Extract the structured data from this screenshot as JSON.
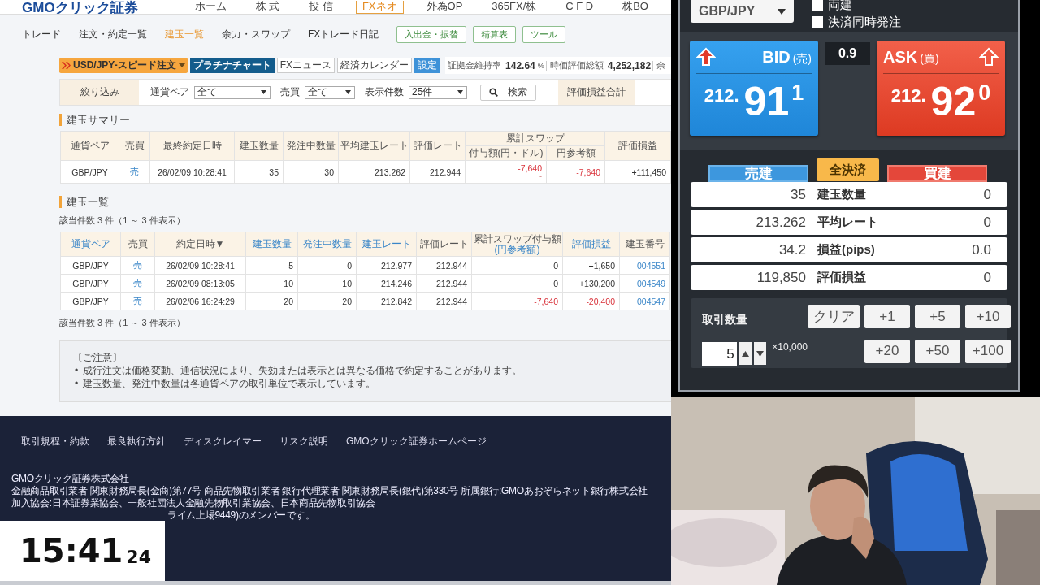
{
  "header": {
    "logo": "GMOクリック証券",
    "nav": [
      {
        "label": "ホーム",
        "selected": false
      },
      {
        "label": "株 式",
        "selected": false
      },
      {
        "label": "投 信",
        "selected": false
      },
      {
        "label": "FXネオ",
        "selected": true
      },
      {
        "label": "外為OP",
        "selected": false
      },
      {
        "label": "365FX/株",
        "selected": false
      },
      {
        "label": "C F D",
        "selected": false
      },
      {
        "label": "株BO",
        "selected": false
      }
    ]
  },
  "subnav": {
    "items": [
      {
        "label": "トレード",
        "selected": false
      },
      {
        "label": "注文・約定一覧",
        "selected": false
      },
      {
        "label": "建玉一覧",
        "selected": true
      },
      {
        "label": "余力・スワップ",
        "selected": false
      },
      {
        "label": "FXトレード日記",
        "selected": false
      }
    ],
    "buttons": [
      "入出金・振替",
      "精算表",
      "ツール"
    ]
  },
  "toolbar": {
    "speed_order": "USD/JPY-スピード注文",
    "buttons": [
      {
        "label": "プラチナチャート",
        "kind": "primary"
      },
      {
        "label": "FXニュース",
        "kind": "plain"
      },
      {
        "label": "経済カレンダー",
        "kind": "plain"
      },
      {
        "label": "設定",
        "kind": "accent"
      }
    ],
    "stats": [
      {
        "label": "証拠金維持率",
        "value": "142.64",
        "unit": "%"
      },
      {
        "label": "時価評価総額",
        "value": "4,252,182"
      },
      {
        "label": "余"
      }
    ]
  },
  "filter": {
    "title": "絞り込み",
    "fields": [
      {
        "label": "通貨ペア",
        "value": "全て"
      },
      {
        "label": "売買",
        "value": "全て"
      },
      {
        "label": "表示件数",
        "value": "25件"
      }
    ],
    "search": "検索",
    "total_label": "評価損益合計"
  },
  "summary": {
    "title": "建玉サマリー",
    "columns": [
      "通貨ペア",
      "売買",
      "最終約定日時",
      "建玉数量",
      "発注中数量",
      "平均建玉レート",
      "評価レート"
    ],
    "swap_group": "累計スワップ",
    "swap_columns": [
      "付与額(円・ドル)",
      "円参考額"
    ],
    "last_column": "評価損益",
    "rows": [
      {
        "cells": [
          "GBP/JPY",
          "売",
          "26/02/09 10:28:41",
          "35",
          "30",
          "213.262",
          "212.944",
          {
            "text": "-7,640",
            "sub": "-",
            "negative": true
          },
          {
            "text": "-7,640",
            "negative": true
          },
          "+111,450"
        ]
      }
    ]
  },
  "positions": {
    "title": "建玉一覧",
    "count": "該当件数 3 件（1 ～ 3 件表示）",
    "count_bottom": "該当件数 3 件（1 ～ 3 件表示）",
    "columns": [
      {
        "label": "通貨ペア",
        "sortable": true
      },
      {
        "label": "売買",
        "sortable": false
      },
      {
        "label": "約定日時▼",
        "sortable": false
      },
      {
        "label": "建玉数量",
        "sortable": true
      },
      {
        "label": "発注中数量",
        "sortable": true
      },
      {
        "label": "建玉レート",
        "sortable": true
      },
      {
        "label": "評価レート",
        "sortable": false
      },
      {
        "label": "累計スワップ付与額",
        "sub": "(円参考額)",
        "sortable": false
      },
      {
        "label": "評価損益",
        "sortable": true
      },
      {
        "label": "建玉番号",
        "sortable": false
      }
    ],
    "rows": [
      {
        "cells": [
          "GBP/JPY",
          "売",
          "26/02/09 10:28:41",
          "5",
          "0",
          "212.977",
          "212.944",
          "0",
          "+1,650",
          "004551"
        ]
      },
      {
        "cells": [
          "GBP/JPY",
          "売",
          "26/02/09 08:13:05",
          "10",
          "10",
          "214.246",
          "212.944",
          "0",
          "+130,200",
          "004549"
        ]
      },
      {
        "cells": [
          "GBP/JPY",
          "売",
          "26/02/06 16:24:29",
          "20",
          "20",
          "212.842",
          "212.944",
          {
            "text": "-7,640",
            "negative": true
          },
          {
            "text": "-20,400",
            "negative": true
          },
          "004547"
        ]
      }
    ]
  },
  "notice": {
    "title": "〔ご注意〕",
    "bullet": "•",
    "items": [
      "成行注文は価格変動、通信状況により、失効または表示とは異なる価格で約定することがあります。",
      "建玉数量、発注中数量は各通貨ペアの取引単位で表示しています。"
    ]
  },
  "footer": {
    "links": [
      "取引規程・約款",
      "最良執行方針",
      "ディスクレイマー",
      "リスク説明",
      "GMOクリック証券ホームページ"
    ],
    "lines": [
      "GMOクリック証券株式会社",
      "金融商品取引業者 関東財務局長(金商)第77号 商品先物取引業者 銀行代理業者 関東財務局長(銀代)第330号 所属銀行:GMOあおぞらネット銀行株式会社",
      "加入協会:日本証券業協会、一般社団法人金融先物取引業協会、日本商品先物取引協会"
    ],
    "last_line": "ライム上場9449)のメンバーです。"
  },
  "clock": {
    "time": "15:41",
    "seconds": "24"
  },
  "panel": {
    "pair": "GBP/JPY",
    "checkboxes": [
      {
        "label": "両建",
        "checked": false
      },
      {
        "label": "決済同時発注",
        "checked": false
      }
    ],
    "quotes": [
      {
        "kind": "bid",
        "label": "BID",
        "side": "(売)",
        "big_figure": "212.",
        "pips": "91",
        "fraction": "1"
      },
      {
        "kind": "ask",
        "label": "ASK",
        "side": "(買)",
        "big_figure": "212.",
        "pips": "92",
        "fraction": "0"
      }
    ],
    "spread": "0.9",
    "actions": [
      {
        "kind": "sell",
        "label": "売建"
      },
      {
        "kind": "close",
        "label": "全決済"
      },
      {
        "kind": "buy",
        "label": "買建"
      }
    ],
    "stats": [
      {
        "sell": "35",
        "label": "建玉数量",
        "buy": "0"
      },
      {
        "sell": "213.262",
        "label": "平均レート",
        "buy": "0"
      },
      {
        "sell": "34.2",
        "label": "損益(pips)",
        "buy": "0.0"
      },
      {
        "sell": "119,850",
        "label": "評価損益",
        "buy": "0"
      }
    ],
    "quantity": {
      "label": "取引数量",
      "value": "5",
      "unit": "×10,000",
      "buttons": [
        "クリア",
        "+1",
        "+5",
        "+10",
        "+20",
        "+50",
        "+100"
      ]
    }
  }
}
